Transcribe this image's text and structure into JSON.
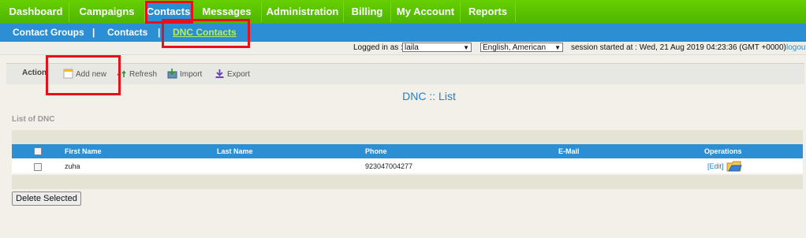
{
  "topnav": {
    "tabs": [
      {
        "label": "Dashboard"
      },
      {
        "label": "Campaigns"
      },
      {
        "label": "Contacts"
      },
      {
        "label": "Messages"
      },
      {
        "label": "Administration"
      },
      {
        "label": "Billing"
      },
      {
        "label": "My Account"
      },
      {
        "label": "Reports"
      }
    ],
    "active": "Contacts"
  },
  "subnav": {
    "items": [
      {
        "label": "Contact Groups"
      },
      {
        "label": "Contacts"
      },
      {
        "label": "DNC Contacts"
      }
    ],
    "separator": "|",
    "active": "DNC Contacts"
  },
  "status": {
    "logged_in_label": "Logged in as :",
    "user_value": "laila",
    "language_value": "English, American",
    "session_text": "session started at : Wed, 21 Aug 2019 04:23:36 (GMT +0000)",
    "logout_label": "logout"
  },
  "actions": {
    "label": "Action",
    "add_new": "Add new",
    "refresh": "Refresh",
    "import": "Import",
    "export": "Export"
  },
  "page_title": "DNC :: List",
  "list_label": "List of DNC",
  "table": {
    "headers": [
      "First Name",
      "Last Name",
      "Phone",
      "E-Mail",
      "Operations"
    ],
    "rows": [
      {
        "first_name": "zuha",
        "last_name": "",
        "phone": "923047004277",
        "email": "",
        "edit": "[Edit]"
      }
    ]
  },
  "delete_button": "Delete Selected",
  "colors": {
    "nav_green": "#4fb400",
    "nav_blue": "#2d8fd3",
    "title_blue": "#2a7ec4",
    "highlight_red": "#e8101a"
  },
  "icons": {
    "add": "new-document-icon",
    "refresh": "refresh-arrows-icon",
    "import": "import-icon",
    "export": "export-arrow-icon",
    "delete": "folder-delete-icon"
  }
}
